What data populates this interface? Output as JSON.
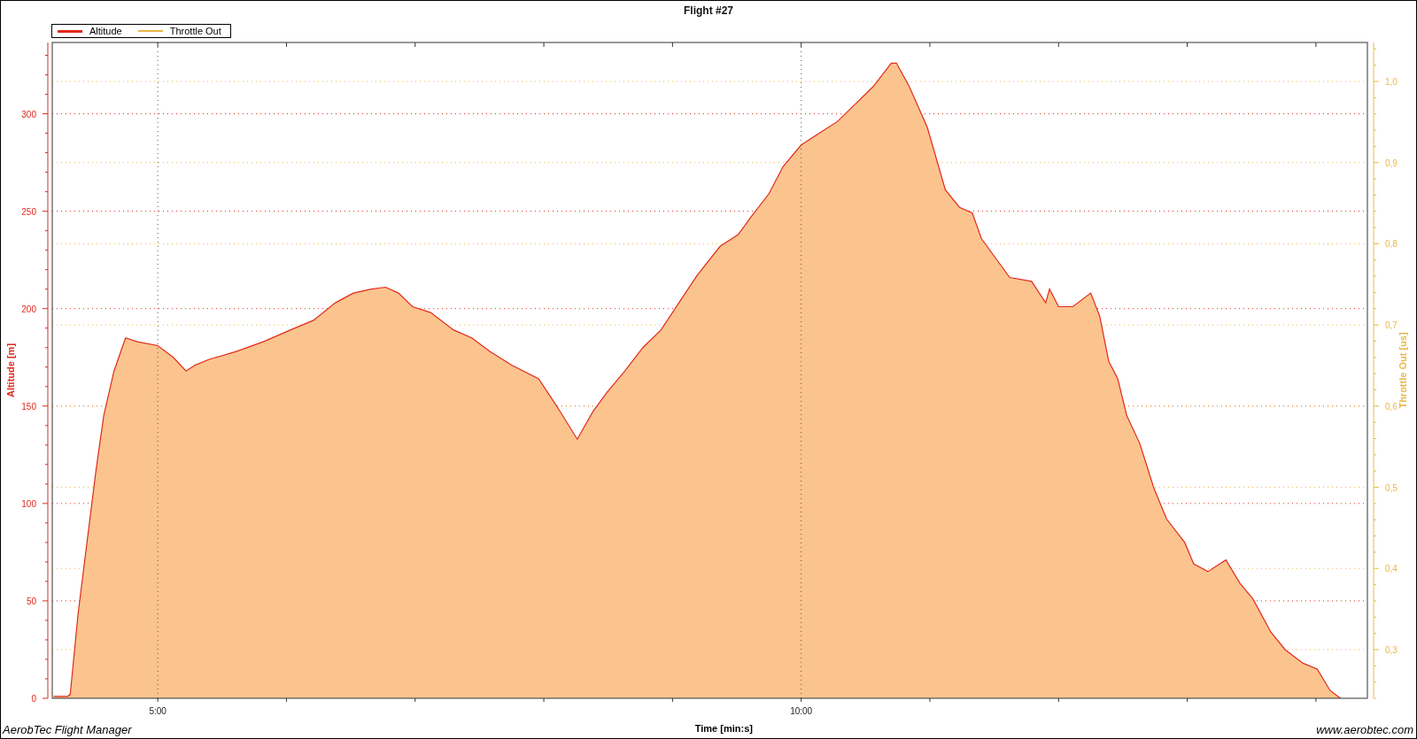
{
  "chart": {
    "legend_extra": [
      {
        "label": "Throttle Out",
        "color": "#e8b84a"
      }
    ],
    "chart_data": {
      "type": "area",
      "grid": true,
      "title": "Flight #27",
      "xlabel": "Time [min:s]",
      "ylabel": "Altitude [m]",
      "y2label": "Throttle Out [us]",
      "x": [
        4.19,
        4.3,
        4.32,
        4.38,
        4.45,
        4.52,
        4.58,
        4.66,
        4.75,
        4.84,
        5.0,
        5.12,
        5.22,
        5.29,
        5.4,
        5.61,
        5.82,
        6.03,
        6.21,
        6.38,
        6.52,
        6.66,
        6.77,
        6.87,
        6.98,
        7.12,
        7.3,
        7.44,
        7.58,
        7.75,
        7.96,
        8.1,
        8.26,
        8.38,
        8.49,
        8.63,
        8.77,
        8.91,
        9.05,
        9.19,
        9.37,
        9.51,
        9.61,
        9.75,
        9.86,
        10.0,
        10.14,
        10.28,
        10.42,
        10.56,
        10.7,
        10.74,
        10.84,
        10.98,
        11.12,
        11.23,
        11.33,
        11.4,
        11.51,
        11.62,
        11.79,
        11.9,
        11.93,
        12.0,
        12.11,
        12.25,
        12.32,
        12.39,
        12.46,
        12.53,
        12.63,
        12.74,
        12.84,
        12.98,
        13.05,
        13.16,
        13.3,
        13.41,
        13.51,
        13.65,
        13.76,
        13.9,
        14.01,
        14.11,
        14.19
      ],
      "series": [
        {
          "name": "Altitude",
          "color": "#e02a1c",
          "values": [
            1,
            1,
            2,
            43,
            80,
            117,
            145,
            168,
            185,
            183,
            181,
            175,
            168,
            171,
            174,
            178,
            183,
            189,
            194,
            203,
            208,
            210,
            211,
            208,
            201,
            198,
            189,
            185,
            178,
            171,
            164,
            150,
            133,
            147,
            157,
            168,
            180,
            189,
            203,
            217,
            232,
            238,
            247,
            259,
            273,
            284,
            290,
            296,
            305,
            314,
            326,
            326,
            314,
            293,
            261,
            252,
            249,
            236,
            226,
            216,
            214,
            203,
            210,
            201,
            201,
            208,
            196,
            173,
            164,
            145,
            131,
            108,
            92,
            80,
            69,
            65,
            71,
            59,
            51,
            34,
            25,
            18,
            15,
            4,
            0
          ]
        }
      ],
      "xlim": [
        4.18,
        14.4
      ],
      "ylim": [
        0,
        336.6
      ],
      "y2lim": [
        0.24,
        1.048
      ],
      "xticks": [
        {
          "value": 5,
          "label": "5:00"
        },
        {
          "value": 10,
          "label": "10:00"
        }
      ],
      "yticks": [
        0,
        50,
        100,
        150,
        200,
        250,
        300
      ],
      "y2ticks": [
        {
          "value": 0.3,
          "label": "0,3"
        },
        {
          "value": 0.4,
          "label": "0,4"
        },
        {
          "value": 0.5,
          "label": "0,5"
        },
        {
          "value": 0.6,
          "label": "0,6"
        },
        {
          "value": 0.7,
          "label": "0,7"
        },
        {
          "value": 0.8,
          "label": "0,8"
        },
        {
          "value": 0.9,
          "label": "0,9"
        },
        {
          "value": 1.0,
          "label": "1,0"
        }
      ]
    }
  },
  "footer": {
    "app_name": "AerobTec Flight Manager",
    "website": "www.aerobtec.com"
  }
}
